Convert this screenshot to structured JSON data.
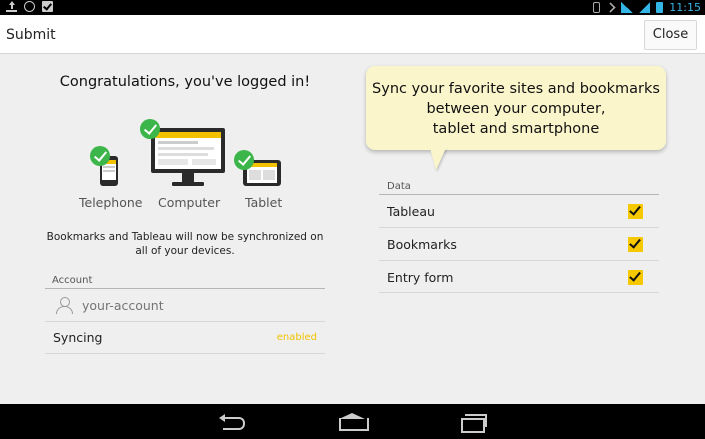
{
  "status_bar": {
    "icons_left": [
      "upload-icon",
      "circle-icon",
      "check-square-icon"
    ],
    "icons_right": [
      "vibrate-icon",
      "notifications-off-icon",
      "wifi-icon",
      "signal-icon",
      "battery-icon"
    ],
    "time": "11:15",
    "accent_color": "#33b5e5"
  },
  "action_bar": {
    "title": "Submit",
    "close_label": "Close"
  },
  "main": {
    "congrats": "Congratulations, you've logged in!",
    "devices": [
      {
        "label": "Telephone",
        "icon": "phone-icon"
      },
      {
        "label": "Computer",
        "icon": "monitor-icon"
      },
      {
        "label": "Tablet",
        "icon": "tablet-icon"
      }
    ],
    "sync_description": "Bookmarks and Tableau will now be synchronized on all of your devices.",
    "account": {
      "header": "Account",
      "placeholder": "your-account",
      "syncing_label": "Syncing",
      "syncing_status": "enabled"
    }
  },
  "tooltip": {
    "text": "Sync your favorite sites and bookmarks\nbetween your computer,\ntablet and smartphone"
  },
  "data_section": {
    "header": "Data",
    "items": [
      {
        "label": "Tableau",
        "checked": true
      },
      {
        "label": "Bookmarks",
        "checked": true
      },
      {
        "label": "Entry form",
        "checked": true
      }
    ]
  },
  "nav_bar": {
    "buttons": [
      "back-icon",
      "home-icon",
      "recent-apps-icon"
    ]
  },
  "colors": {
    "check_green": "#3cb54a",
    "checkbox_yellow": "#f6c800",
    "tooltip_bg": "#fbf5cc"
  }
}
